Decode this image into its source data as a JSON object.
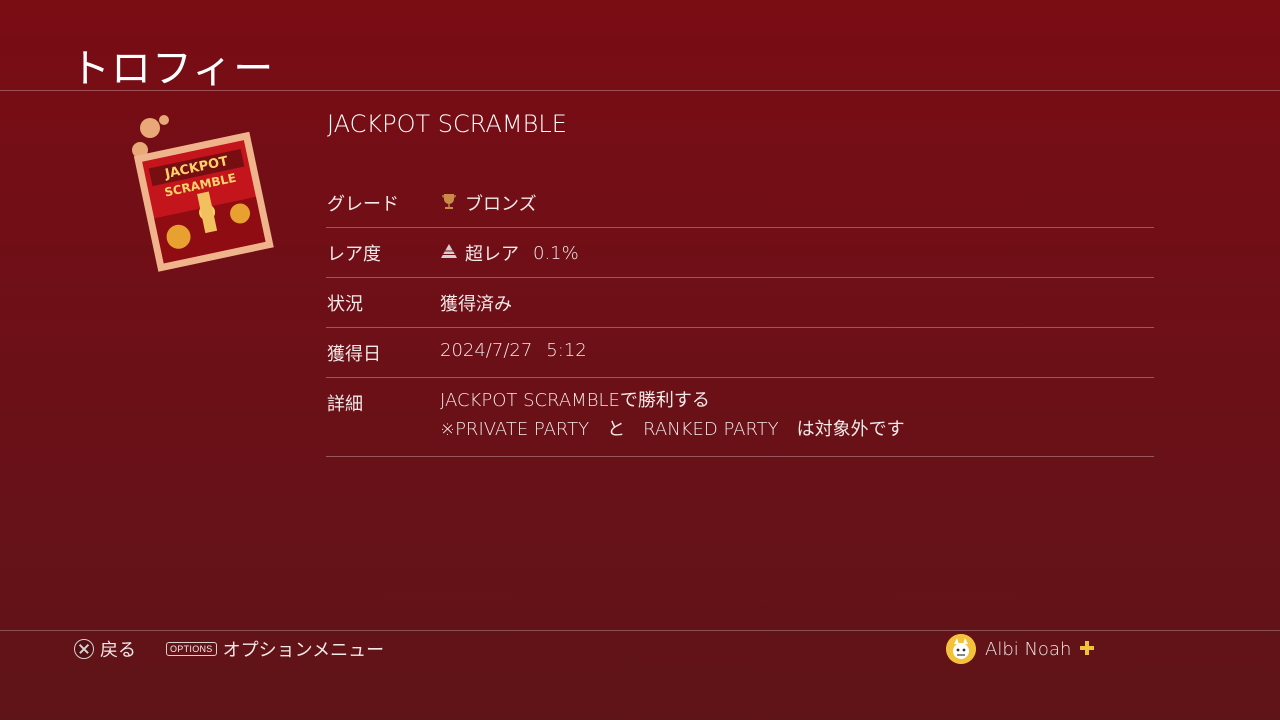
{
  "header": {
    "title": "トロフィー"
  },
  "trophy": {
    "name": "JACKPOT SCRAMBLE",
    "thumbnail": {
      "icon": "jackpot-scramble-trophy-art",
      "art_text": "JACKPOT SCRAMBLE"
    }
  },
  "details": {
    "grade": {
      "label": "グレード",
      "value": "ブロンズ",
      "icon": "bronze-trophy-icon",
      "color": "#c07a3a"
    },
    "rarity": {
      "label": "レア度",
      "tier": "超レア",
      "percent": "0.1%",
      "icon": "ultra-rare-pyramid-icon"
    },
    "status": {
      "label": "状況",
      "value": "獲得済み"
    },
    "earned": {
      "label": "獲得日",
      "date": "2024/7/27",
      "time": "5:12"
    },
    "description": {
      "label": "詳細",
      "line1": "JACKPOT SCRAMBLEで勝利する",
      "line2": "※PRIVATE PARTY　と　RANKED PARTY　は対象外です"
    }
  },
  "footer": {
    "back_label": "戻る",
    "options_key": "OPTIONS",
    "options_label": "オプションメニュー",
    "username": "Albi Noah",
    "plus_icon": "playstation-plus-icon"
  },
  "colors": {
    "background": "#6f0f17",
    "accent": "#f0c23c"
  }
}
